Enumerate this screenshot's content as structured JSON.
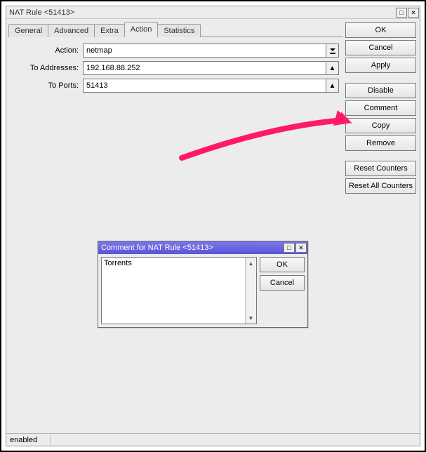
{
  "window": {
    "title": "NAT Rule <51413>"
  },
  "tabs": {
    "general": "General",
    "advanced": "Advanced",
    "extra": "Extra",
    "action": "Action",
    "statistics": "Statistics",
    "active": "action"
  },
  "form": {
    "action": {
      "label": "Action:",
      "value": "netmap"
    },
    "to_addresses": {
      "label": "To Addresses:",
      "value": "192.168.88.252"
    },
    "to_ports": {
      "label": "To Ports:",
      "value": "51413"
    }
  },
  "buttons": {
    "ok": "OK",
    "cancel": "Cancel",
    "apply": "Apply",
    "disable": "Disable",
    "comment": "Comment",
    "copy": "Copy",
    "remove": "Remove",
    "reset_counters": "Reset Counters",
    "reset_all_counters": "Reset All Counters"
  },
  "status": {
    "enabled": "enabled"
  },
  "comment_popup": {
    "title": "Comment for NAT Rule <51413>",
    "value": "Torrents",
    "ok": "OK",
    "cancel": "Cancel"
  },
  "annotation": {
    "arrow_color": "#ff1a66"
  }
}
